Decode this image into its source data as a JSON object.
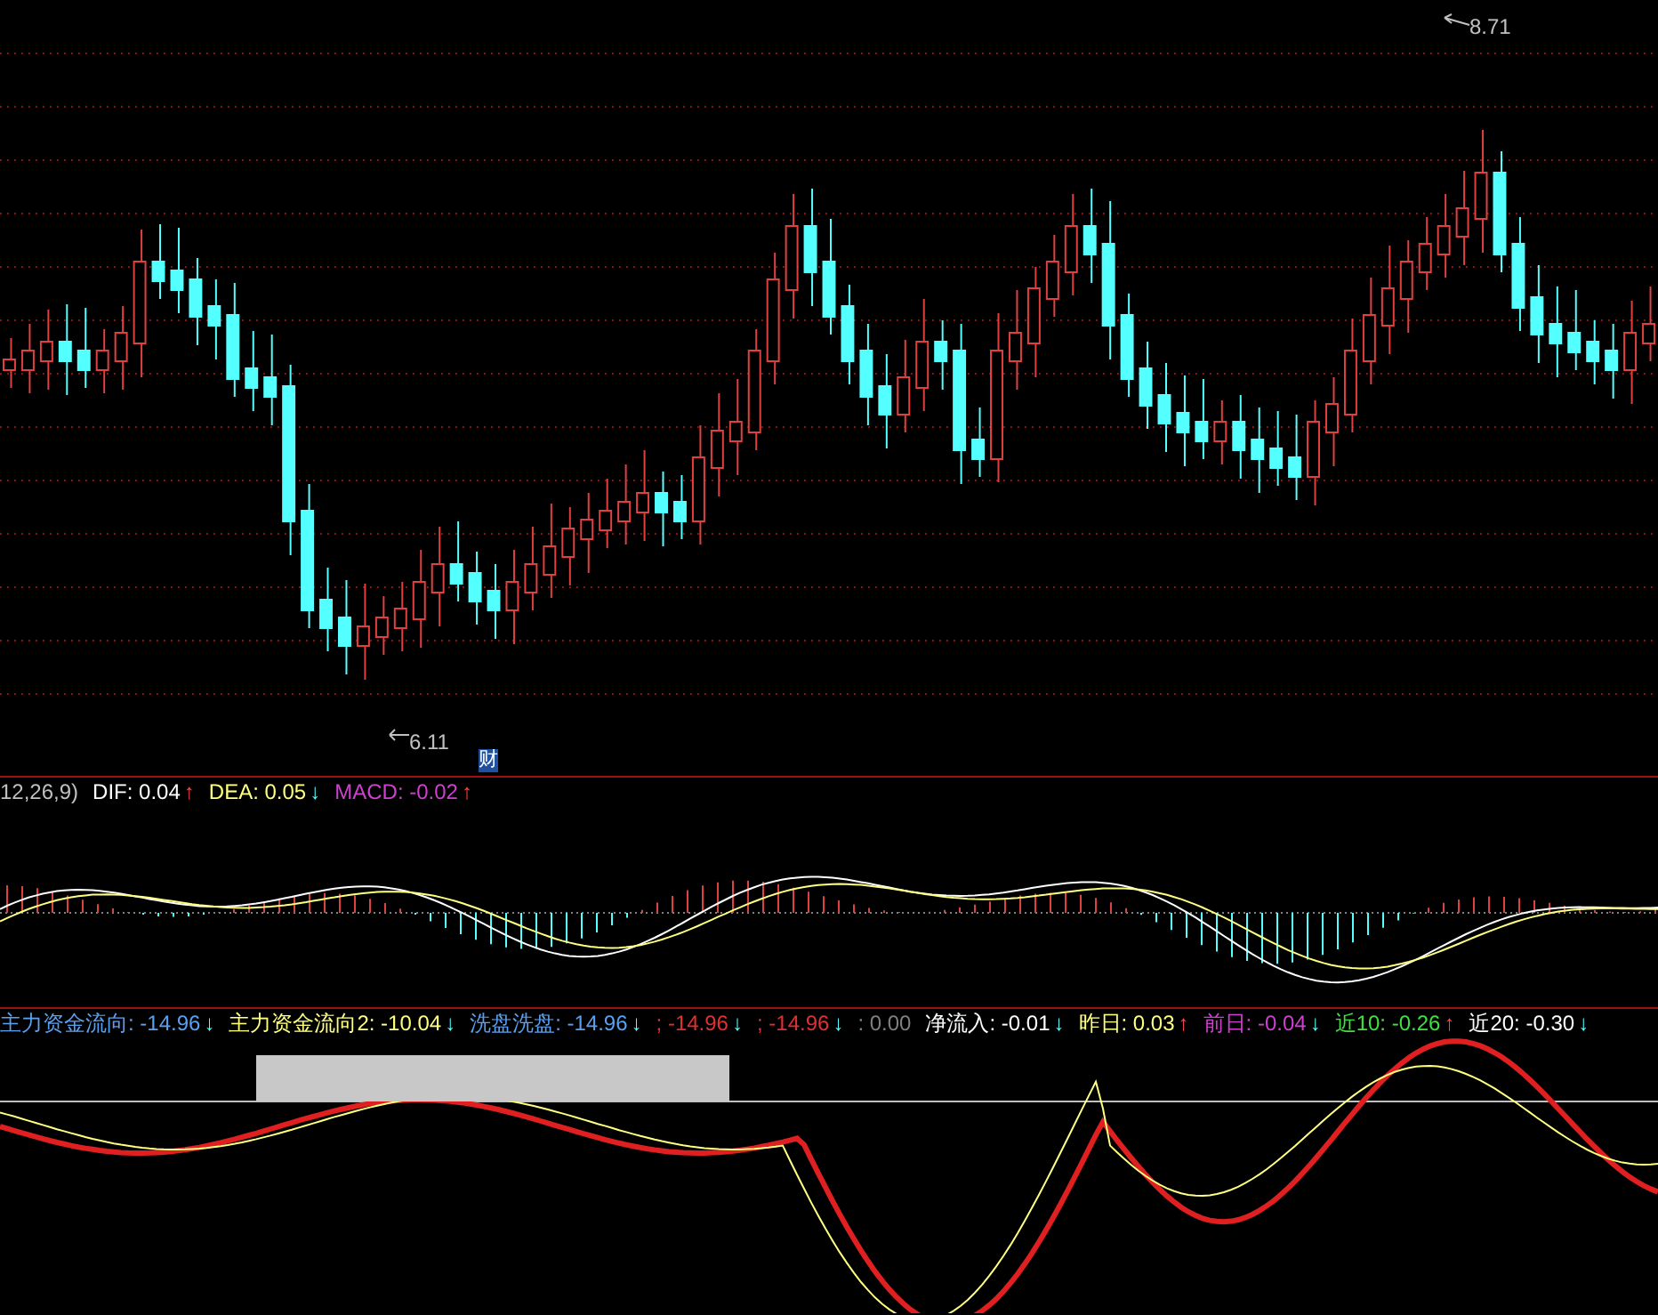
{
  "price_panel": {
    "high_label": "8.71",
    "low_label": "6.11",
    "badge": "财"
  },
  "macd_panel": {
    "legend": [
      {
        "text": "12,26,9)",
        "color": "#c0c0c0"
      },
      {
        "text": "DIF: 0.04",
        "color": "#ffffff",
        "arrow": "↑",
        "rising": true
      },
      {
        "text": "DEA: 0.05",
        "color": "#ffff80",
        "arrow": "↓",
        "rising": false
      },
      {
        "text": "MACD: -0.02",
        "color": "#d040d0",
        "arrow": "↑",
        "rising": true
      }
    ]
  },
  "flow_panel": {
    "legend": [
      {
        "text": "主力资金流向: -14.96",
        "color": "#5aa0f0",
        "arrow": "↓",
        "rising": false
      },
      {
        "text": "主力资金流向2: -10.04",
        "color": "#ffff80",
        "arrow": "↓",
        "rising": false
      },
      {
        "text": "洗盘洗盘: -14.96",
        "color": "#5aa0f0",
        "arrow": "↓",
        "rising": false
      },
      {
        "text": "; -14.96",
        "color": "#e03030",
        "arrow": "↓",
        "rising": false
      },
      {
        "text": "; -14.96",
        "color": "#e03030",
        "arrow": "↓",
        "rising": false
      },
      {
        "text": ": 0.00",
        "color": "#808080"
      },
      {
        "text": "净流入: -0.01",
        "color": "#ffffff",
        "arrow": "↓",
        "rising": false
      },
      {
        "text": "昨日: 0.03",
        "color": "#ffff80",
        "arrow": "↑",
        "rising": true
      },
      {
        "text": "前日: -0.04",
        "color": "#d040d0",
        "arrow": "↓",
        "rising": false
      },
      {
        "text": "近10: -0.26",
        "color": "#40e040",
        "arrow": "↑",
        "rising": true
      },
      {
        "text": "近20: -0.30",
        "color": "#ffffff",
        "arrow": "↓",
        "rising": false
      }
    ]
  }
}
